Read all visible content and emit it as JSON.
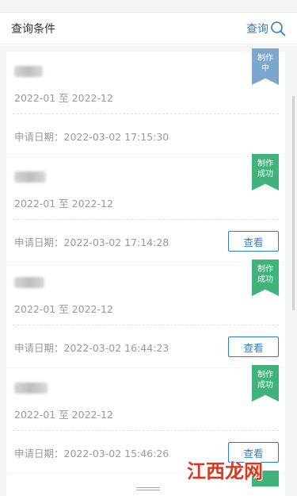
{
  "header": {
    "title": "查询条件",
    "query_label": "查询"
  },
  "cards": [
    {
      "range": "2022-01 至 2022-12",
      "date": "申请日期：2022-03-02 17:15:30",
      "status": "制作中",
      "status_line1": "制作",
      "status_line2": "中",
      "status_color": "#7ba7cf",
      "has_view": false
    },
    {
      "range": "2022-01 至 2022-12",
      "date": "申请日期：2022-03-02 17:14:28",
      "status": "制作成功",
      "status_line1": "制作",
      "status_line2": "成功",
      "status_color": "#3fb37a",
      "has_view": true,
      "view_label": "查看"
    },
    {
      "range": "2022-01 至 2022-12",
      "date": "申请日期：2022-03-02 16:44:23",
      "status": "制作成功",
      "status_line1": "制作",
      "status_line2": "成功",
      "status_color": "#3fb37a",
      "has_view": true,
      "view_label": "查看"
    },
    {
      "range": "2022-01 至 2022-12",
      "date": "申请日期：2022-03-02 15:46:26",
      "status": "制作成功",
      "status_line1": "制作",
      "status_line2": "成功",
      "status_color": "#3fb37a",
      "has_view": true,
      "view_label": "查看"
    }
  ],
  "watermark": {
    "text": "江西龙网"
  },
  "colors": {
    "accent": "#2b7cd3",
    "in_progress": "#7ba7cf",
    "success": "#3fb37a"
  }
}
